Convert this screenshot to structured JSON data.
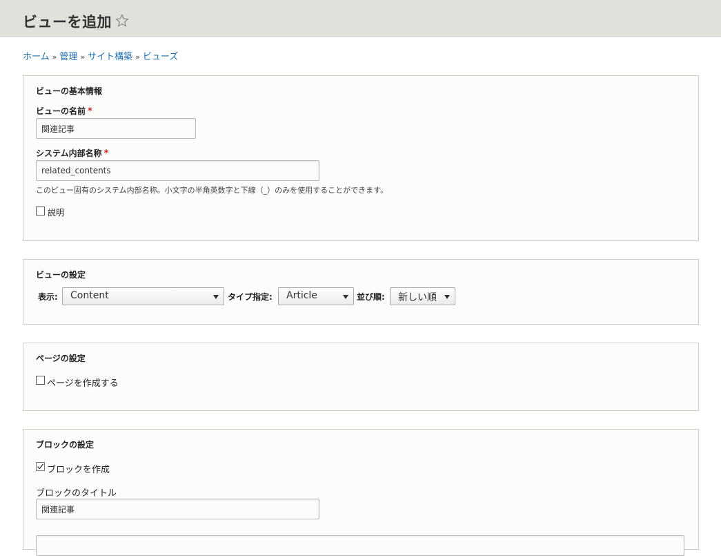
{
  "header": {
    "title": "ビューを追加",
    "star_icon": "star-outline-icon"
  },
  "breadcrumb": {
    "items": [
      "ホーム",
      "管理",
      "サイト構築",
      "ビューズ"
    ],
    "separator": "»"
  },
  "basic_info": {
    "legend": "ビューの基本情報",
    "view_name_label": "ビューの名前",
    "view_name_value": "関連記事",
    "machine_name_label": "システム内部名称",
    "machine_name_value": "related_contents",
    "machine_name_description": "このビュー固有のシステム内部名称。小文字の半角英数字と下線（_）のみを使用することができます。",
    "description_checkbox_label": "説明",
    "required_marker": "*"
  },
  "view_settings": {
    "legend": "ビューの設定",
    "show_label": "表示:",
    "show_value": "Content",
    "type_label": "タイプ指定:",
    "type_value": "Article",
    "sort_label": "並び順:",
    "sort_value": "新しい順"
  },
  "page_settings": {
    "legend": "ページの設定",
    "create_page_label": "ページを作成する"
  },
  "block_settings": {
    "legend": "ブロックの設定",
    "create_block_label": "ブロックを作成",
    "create_block_checked": true,
    "block_title_label": "ブロックのタイトル",
    "block_title_value": "関連記事"
  },
  "colors": {
    "header_bg": "#e1e0da",
    "link": "#1f6fad",
    "required": "#cc2222"
  }
}
